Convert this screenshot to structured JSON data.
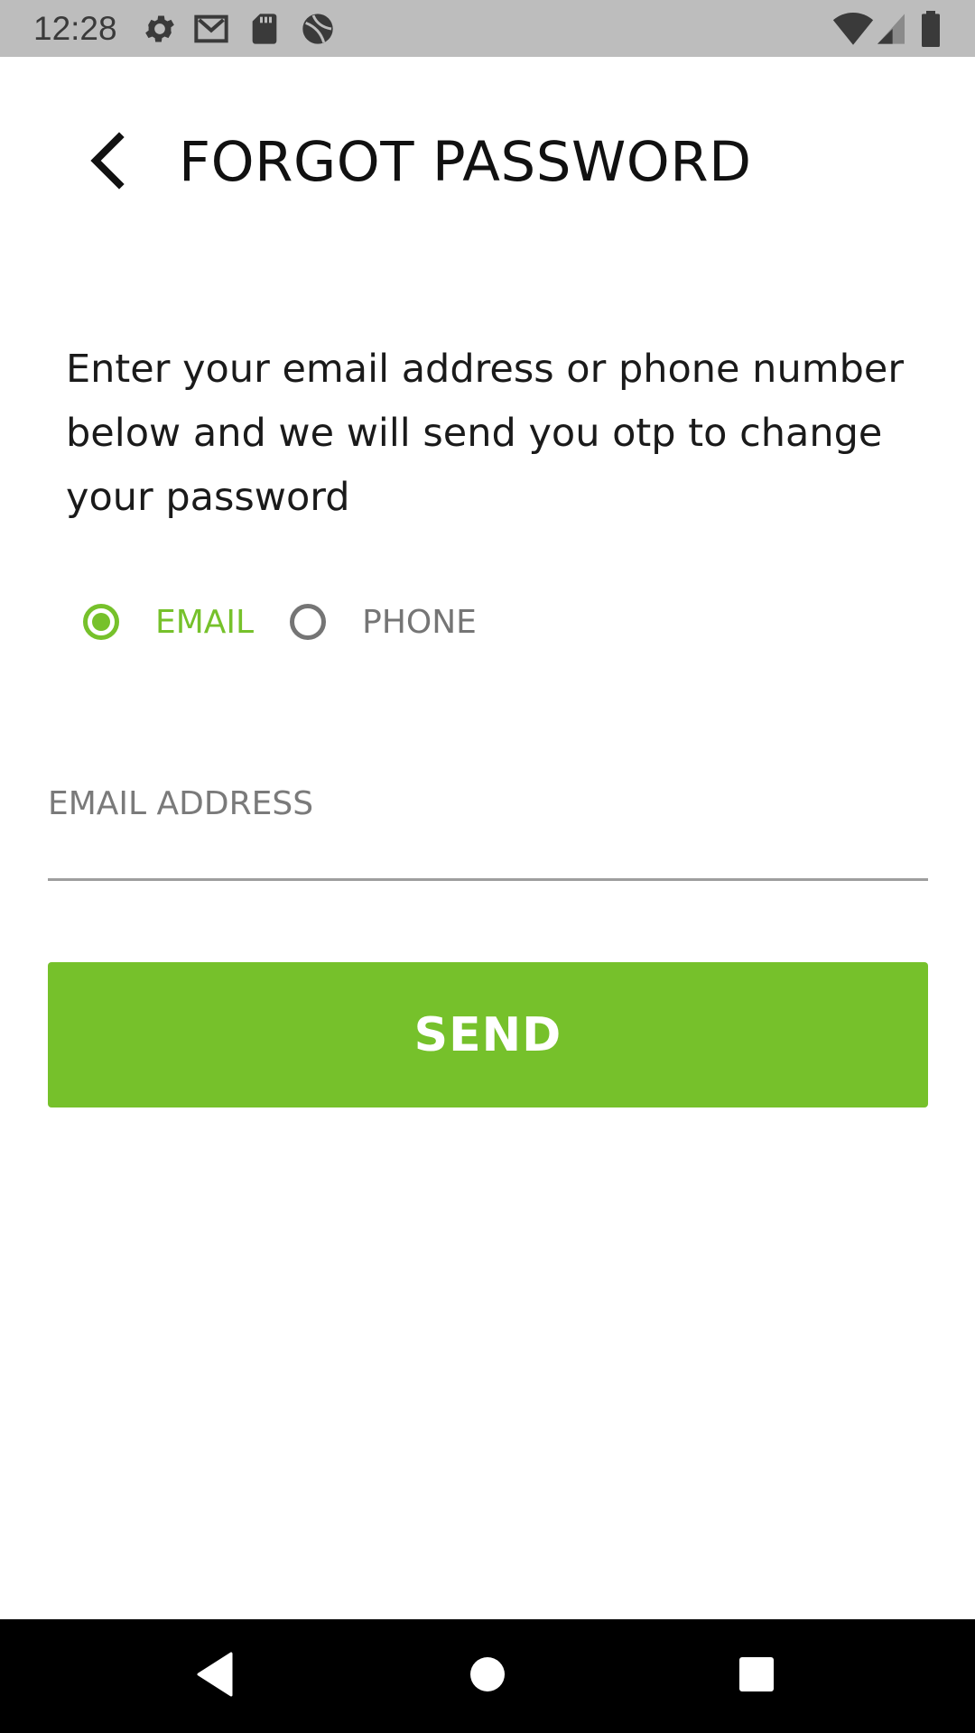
{
  "status_bar": {
    "time": "12:28",
    "icons": [
      "gear-icon",
      "gmail-icon",
      "sd-card-icon",
      "sports-ball-icon",
      "wifi-icon",
      "signal-icon",
      "battery-icon"
    ]
  },
  "header": {
    "back_icon": "chevron-left-icon",
    "title": "FORGOT PASSWORD"
  },
  "instructions": "Enter your email address or phone number below and we will send you otp to change your password",
  "contact_method": {
    "options": [
      {
        "label": "EMAIL",
        "selected": true
      },
      {
        "label": "PHONE",
        "selected": false
      }
    ]
  },
  "email_field": {
    "value": "",
    "placeholder": "EMAIL ADDRESS"
  },
  "send_button": {
    "label": "SEND"
  },
  "colors": {
    "accent": "#76c12b",
    "status_bar": "#bdbdbd",
    "nav_bar": "#000000",
    "unselected": "#757575"
  },
  "nav_bar": {
    "buttons": [
      "back-triangle-icon",
      "home-circle-icon",
      "recents-square-icon"
    ]
  }
}
